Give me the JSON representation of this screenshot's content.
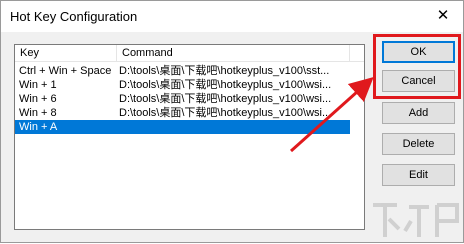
{
  "window": {
    "title": "Hot Key Configuration",
    "close_glyph": "✕"
  },
  "list": {
    "columns": [
      "Key",
      "Command"
    ],
    "rows": [
      {
        "key": "Ctrl + Win + Space",
        "command": "D:\\tools\\桌面\\下载吧\\hotkeyplus_v100\\sst..."
      },
      {
        "key": "Win + 1",
        "command": "D:\\tools\\桌面\\下载吧\\hotkeyplus_v100\\wsi..."
      },
      {
        "key": "Win + 6",
        "command": "D:\\tools\\桌面\\下载吧\\hotkeyplus_v100\\wsi..."
      },
      {
        "key": "Win + 8",
        "command": "D:\\tools\\桌面\\下载吧\\hotkeyplus_v100\\wsi..."
      },
      {
        "key": "Win + A",
        "command": ""
      }
    ],
    "selected_index": 4
  },
  "buttons": {
    "ok": "OK",
    "cancel": "Cancel",
    "add": "Add",
    "delete": "Delete",
    "edit": "Edit"
  },
  "colors": {
    "selection": "#0078d7",
    "annotation_red": "#e0191d"
  }
}
